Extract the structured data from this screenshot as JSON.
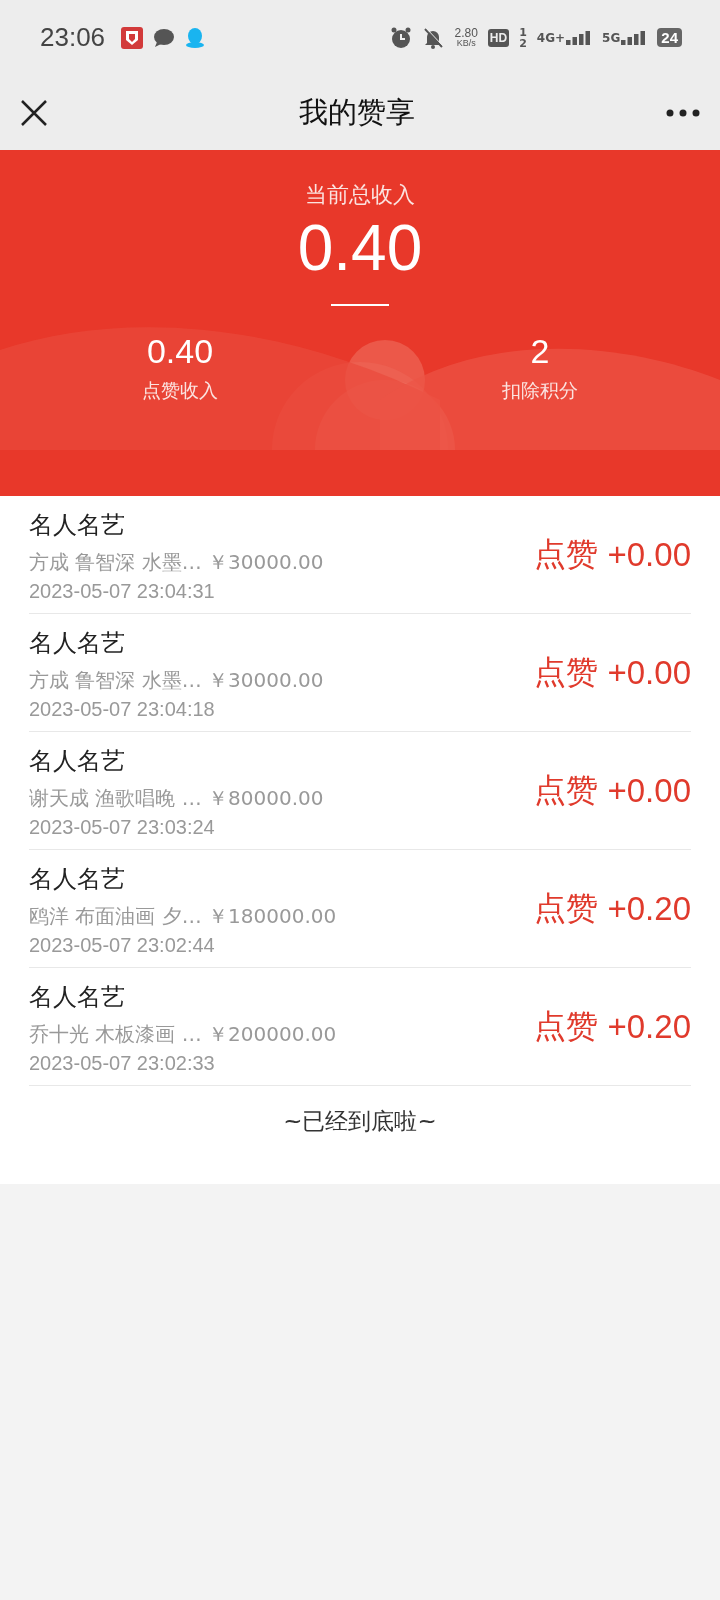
{
  "status_bar": {
    "time": "23:06",
    "net_speed": "2.80",
    "net_unit": "KB/s",
    "hd": "HD",
    "hd_sims": [
      "1",
      "2"
    ],
    "net1": "4G+",
    "net2": "5G",
    "battery": "24"
  },
  "nav": {
    "title": "我的赞享"
  },
  "summary": {
    "label": "当前总收入",
    "total": "0.40",
    "stats": [
      {
        "value": "0.40",
        "label": "点赞收入"
      },
      {
        "value": "2",
        "label": "扣除积分"
      }
    ]
  },
  "records": [
    {
      "title": "名人名艺",
      "detail": "方成 鲁智深 水墨… ￥30000.00",
      "time": "2023-05-07 23:04:31",
      "action": "点赞",
      "amount": "+0.00"
    },
    {
      "title": "名人名艺",
      "detail": "方成 鲁智深 水墨… ￥30000.00",
      "time": "2023-05-07 23:04:18",
      "action": "点赞",
      "amount": "+0.00"
    },
    {
      "title": "名人名艺",
      "detail": "谢天成 渔歌唱晚 … ￥80000.00",
      "time": "2023-05-07 23:03:24",
      "action": "点赞",
      "amount": "+0.00"
    },
    {
      "title": "名人名艺",
      "detail": "鸥洋 布面油画 夕… ￥180000.00",
      "time": "2023-05-07 23:02:44",
      "action": "点赞",
      "amount": "+0.20"
    },
    {
      "title": "名人名艺",
      "detail": "乔十光 木板漆画 … ￥200000.00",
      "time": "2023-05-07 23:02:33",
      "action": "点赞",
      "amount": "+0.20"
    }
  ],
  "footer": "~已经到底啦~"
}
